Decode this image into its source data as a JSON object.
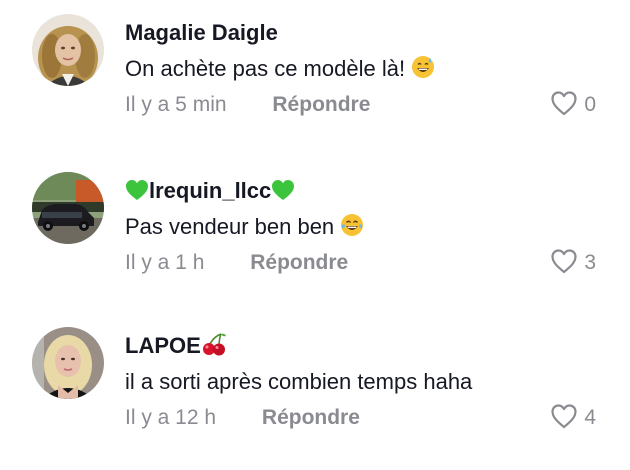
{
  "comments": [
    {
      "username": "Magalie Daigle",
      "text": "On achète pas ce modèle là!",
      "text_emoji": "grinning-sweat-emoji",
      "timestamp": "Il y a 5 min",
      "reply_label": "Répondre",
      "like_count": "0"
    },
    {
      "username": "lrequin_llcc",
      "username_prefix_emoji": "green-heart-emoji",
      "username_suffix_emoji": "green-heart-emoji",
      "text": "Pas vendeur ben ben",
      "text_emoji": "tears-of-joy-emoji",
      "timestamp": "Il y a 1 h",
      "reply_label": "Répondre",
      "like_count": "3"
    },
    {
      "username": "LAPOE",
      "username_suffix_emoji": "cherries-emoji",
      "text": "il a sorti après combien temps haha",
      "timestamp": "Il y a 12 h",
      "reply_label": "Répondre",
      "like_count": "4"
    }
  ],
  "colors": {
    "text": "#161823",
    "secondary": "#8a8b91",
    "green_heart": "#3cc43c",
    "cherry": "#d9122b"
  }
}
